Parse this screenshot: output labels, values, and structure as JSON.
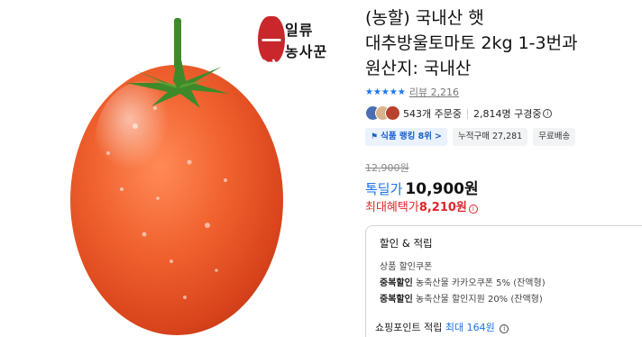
{
  "product": {
    "title_line1": "(농할) 국내산 햇",
    "title_line2": "대추방울토마토 2kg 1-3번과",
    "title_line3": "원산지: 국내산",
    "image_seal_glyph": "一流",
    "image_seal_line1": "일류",
    "image_seal_line2": "농사꾼"
  },
  "rating": {
    "stars": "★★★★★",
    "value": 5,
    "review_label": "리뷰 2,216"
  },
  "social": {
    "orders": "543개 주문중",
    "viewers": "2,814명 구경중"
  },
  "badges": {
    "rank_icon": "flag-icon",
    "rank_label": "식품 랭킹 8위",
    "rank_arrow": ">",
    "cumulative": "누적구매 27,281",
    "shipping": "무료배송"
  },
  "price": {
    "original": "12,900원",
    "deal_label": "톡딜가",
    "deal_value": "10,900원",
    "max_label": "최대혜택가",
    "max_value": "8,210원"
  },
  "benefits": {
    "title": "할인 & 적립",
    "coupon_label": "상품 할인쿠폰",
    "dup1_label": "중복할인",
    "dup1_text": "농축산물 카카오쿠폰 5% (잔액형)",
    "dup2_label": "중복할인",
    "dup2_text": "농축산물 할인지원 20% (잔액형)",
    "points_label": "쇼핑포인트 적립",
    "points_value": "최대 164원"
  },
  "colors": {
    "accent_blue": "#1a73e8",
    "accent_red": "#e0252b",
    "tomato": "#e8532a"
  }
}
